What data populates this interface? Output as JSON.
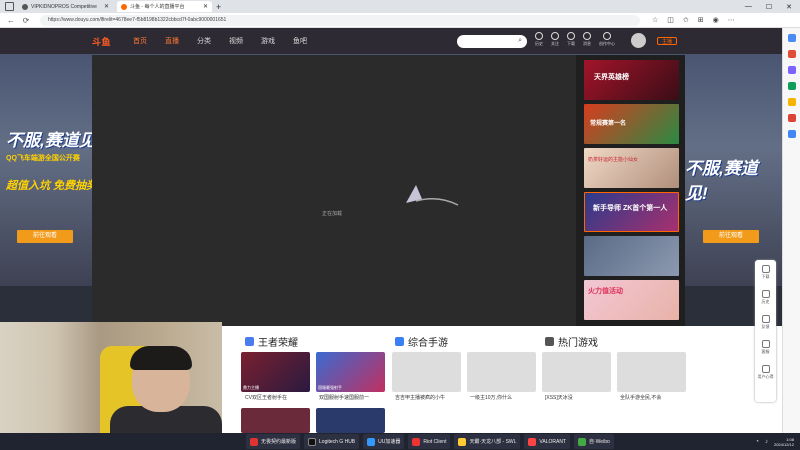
{
  "browser": {
    "tabs": [
      {
        "title": "VIPKIDNOPROS Competitive"
      },
      {
        "title": "斗鱼 - 每个人的直播平台"
      }
    ],
    "url": "https://www.douyu.com/lfirelit=4678ee7-f5b8198b1322cbbcd7f-0abc9000001651",
    "new_tab_label": "+"
  },
  "site": {
    "logo": "斗鱼",
    "nav": [
      "首页",
      "直播",
      "分类",
      "视频",
      "游戏",
      "鱼吧"
    ],
    "header_icons": [
      "历史",
      "关注",
      "下载",
      "消息",
      "创作中心"
    ],
    "user_badge": "主播"
  },
  "banner": {
    "left_big": "不服,赛道见!",
    "left_sub": "QQ飞车端游全国公开赛",
    "left_yellow": "超值入坑 免费抽奖",
    "left_button": "前往观看",
    "right_big": "不服,赛道见!",
    "right_button": "前往观看"
  },
  "player": {
    "loading_text": "正在加载"
  },
  "sidebar_thumbs": [
    {
      "text": "天界英雄榜"
    },
    {
      "text": "常规赛第一名"
    },
    {
      "text": "奶茶好运的主能小仙女"
    },
    {
      "text": "新手导师 ZK首个第一人"
    },
    {
      "text": ""
    },
    {
      "text": "火力值活动"
    }
  ],
  "sections": [
    {
      "title": "王者荣耀"
    },
    {
      "title": "综合手游"
    },
    {
      "title": "热门游戏"
    }
  ],
  "cards": [
    {
      "label": "鼎力主播",
      "title": "CV双区王者射手在"
    },
    {
      "label": "国服最强射手",
      "title": "双国服射手速国服前一"
    },
    {
      "label": "",
      "title": "吉吉甲主播被疯的小牛"
    },
    {
      "label": "",
      "title": "一级主10万,你什么"
    },
    {
      "label": "",
      "title": "[XSS]天冰没"
    },
    {
      "label": "",
      "title": "全队手游全民,不会"
    }
  ],
  "tools": [
    "下载",
    "历史",
    "反馈",
    "客服",
    "用户心得"
  ],
  "taskbar": {
    "apps": [
      "无畏契约最新版",
      "Logitech G HUB",
      "UU加速器",
      "Riot Client",
      "天霸·天龙八部 - SWL",
      "VALORANT",
      "自·Weibo"
    ],
    "time": "1:08",
    "date": "2024/12/12"
  },
  "colors": {
    "accent": "#ff5d23",
    "button": "#f29b1a",
    "page_bg": "#2b2f3a"
  }
}
